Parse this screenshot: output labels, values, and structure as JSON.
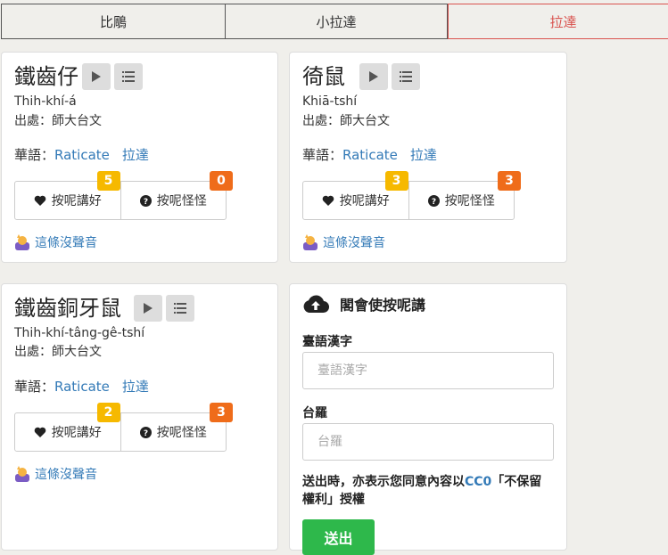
{
  "tabs": [
    {
      "label": "比鵰"
    },
    {
      "label": "小拉達"
    },
    {
      "label": "拉達"
    }
  ],
  "cards": [
    {
      "word": "鐵齒仔",
      "romanization": "Thih-khí-á",
      "source": "出處：師大台文",
      "mandarin_label": "華語：",
      "mandarin_en": "Raticate",
      "mandarin_zh": "拉達",
      "good_label": "按呢講好",
      "good_count": "5",
      "strange_label": "按呢怪怪",
      "strange_count": "0",
      "no_sound": "這條沒聲音"
    },
    {
      "word": "徛鼠",
      "romanization": "Khiā-tshí",
      "source": "出處：師大台文",
      "mandarin_label": "華語：",
      "mandarin_en": "Raticate",
      "mandarin_zh": "拉達",
      "good_label": "按呢講好",
      "good_count": "3",
      "strange_label": "按呢怪怪",
      "strange_count": "3",
      "no_sound": "這條沒聲音"
    },
    {
      "word": "鐵齒銅牙鼠",
      "romanization": "Thih-khí-tâng-gê-tshí",
      "source": "出處：師大台文",
      "mandarin_label": "華語：",
      "mandarin_en": "Raticate",
      "mandarin_zh": "拉達",
      "good_label": "按呢講好",
      "good_count": "2",
      "strange_label": "按呢怪怪",
      "strange_count": "3",
      "no_sound": "這條沒聲音"
    }
  ],
  "form": {
    "title": "閣會使按呢講",
    "hanzi_label": "臺語漢字",
    "hanzi_placeholder": "臺語漢字",
    "roman_label": "台羅",
    "roman_placeholder": "台羅",
    "consent_before": "送出時，亦表示您同意內容以",
    "consent_link": "CC0",
    "consent_after": "「不保留權利」授權",
    "submit_label": "送出"
  },
  "colors": {
    "active_tab": "#d9534f",
    "link": "#337ab7",
    "badge_yellow": "#f6b900",
    "badge_orange": "#ef6c1a",
    "submit": "#2eb84b"
  },
  "icons": {
    "play": "play-icon",
    "list": "list-icon",
    "heart": "heart-icon",
    "question": "question-circle-icon",
    "upload": "cloud-upload-icon",
    "emoji": "person-raising-hand-icon"
  }
}
